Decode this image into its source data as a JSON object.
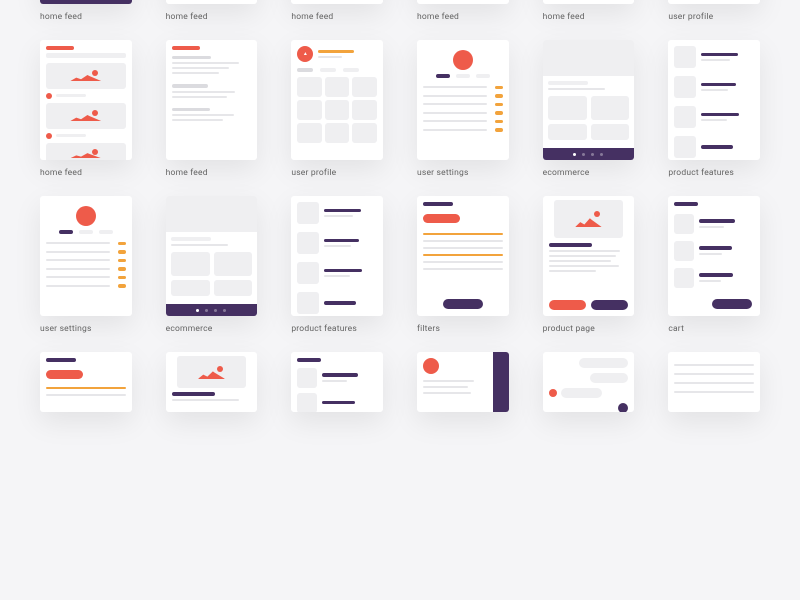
{
  "labels": {
    "home_feed": "home feed",
    "user_profile": "user profile",
    "user_settings": "user settings",
    "ecommerce": "ecommerce",
    "product_features": "product features",
    "filters": "filters",
    "product_page": "product page",
    "cart": "cart"
  },
  "rows": [
    [
      "home_feed",
      "home_feed",
      "home_feed",
      "home_feed",
      "home_feed",
      "user_profile"
    ],
    [
      "home_feed",
      "home_feed",
      "user_profile",
      "user_settings",
      "ecommerce",
      "product_features"
    ],
    [
      "user_settings",
      "ecommerce",
      "product_features",
      "filters",
      "product_page",
      "cart"
    ],
    [
      "filters",
      "product_page",
      "cart",
      "",
      "",
      ""
    ]
  ],
  "colors": {
    "purple": "#453062",
    "red": "#ee5b4a",
    "orange": "#f2a33c",
    "grey": "#efeff1"
  }
}
